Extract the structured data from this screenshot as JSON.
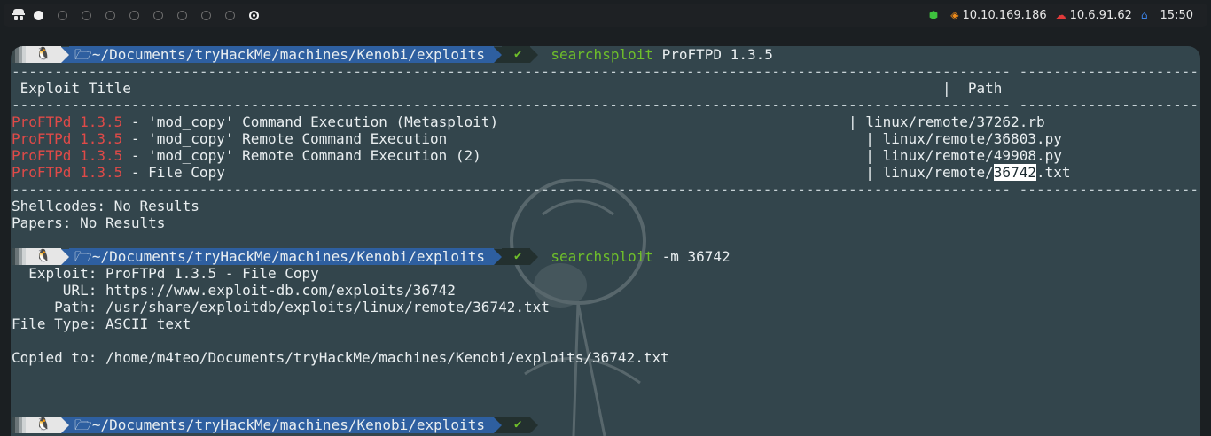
{
  "topbar": {
    "workspaces": [
      "active",
      "empty",
      "empty",
      "empty",
      "empty",
      "empty",
      "empty",
      "empty",
      "empty",
      "target"
    ],
    "status": [
      {
        "icon": "cube-icon",
        "text": "",
        "color": "#3ec23e"
      },
      {
        "icon": "target-icon",
        "text": "10.10.169.186",
        "color": "#f08c1a"
      },
      {
        "icon": "cloud-icon",
        "text": "10.6.91.62",
        "color": "#e03a3a"
      },
      {
        "icon": "home-icon",
        "text": "",
        "color": "#3b82e6"
      },
      {
        "icon": "",
        "text": "15:50",
        "color": "#e8e8e8"
      }
    ]
  },
  "prompt": {
    "os_icon": "🐧",
    "path": "~/Documents/tryHackMe/machines/Kenobi/exploits",
    "ok": "✔"
  },
  "cmd1": {
    "name": "searchsploit",
    "args": "ProFTPD 1.3.5"
  },
  "table": {
    "col_title": "Exploit Title",
    "col_path": "Path",
    "rows": [
      {
        "match": "ProFTPd 1.3.5",
        "title": " - 'mod_copy' Command Execution (Metasploit)",
        "path": "linux/remote/37262.rb"
      },
      {
        "match": "ProFTPd 1.3.5",
        "title": " - 'mod_copy' Remote Command Execution",
        "path": "linux/remote/36803.py"
      },
      {
        "match": "ProFTPd 1.3.5",
        "title": " - 'mod_copy' Remote Command Execution (2)",
        "path": "linux/remote/49908.py"
      },
      {
        "match": "ProFTPd 1.3.5",
        "title": " - File Copy",
        "path_pre": "linux/remote/",
        "path_hl": "36742",
        "path_post": ".txt"
      }
    ],
    "shellcodes": "Shellcodes: No Results",
    "papers": "Papers: No Results"
  },
  "cmd2": {
    "name": "searchsploit",
    "args": "-m 36742"
  },
  "mirror": {
    "exploit": "  Exploit: ProFTPd 1.3.5 - File Copy",
    "url": "      URL: https://www.exploit-db.com/exploits/36742",
    "path": "     Path: /usr/share/exploitdb/exploits/linux/remote/36742.txt",
    "filetype": "File Type: ASCII text",
    "copied": "Copied to: /home/m4teo/Documents/tryHackMe/machines/Kenobi/exploits/36742.txt"
  }
}
